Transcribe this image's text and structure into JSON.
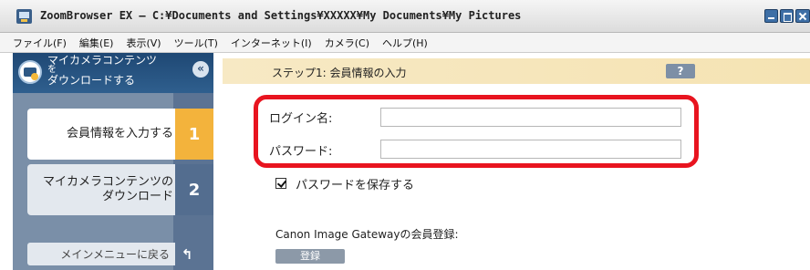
{
  "window": {
    "title": "ZoomBrowser EX  –  C:¥Documents and Settings¥XXXXX¥My Documents¥My Pictures",
    "icon": "zoombrowser-app-icon"
  },
  "menu": [
    "ファイル(F)",
    "編集(E)",
    "表示(V)",
    "ツール(T)",
    "インターネット(I)",
    "カメラ(C)",
    "ヘルプ(H)"
  ],
  "sidebar": {
    "title_line1": "マイカメラコンテンツ",
    "title_line2": "を",
    "title_line3": "ダウンロードする",
    "collapse_glyph": "«",
    "steps": [
      {
        "label": "会員情報を入力する",
        "number": "1",
        "state": "active"
      },
      {
        "label_line1": "マイカメラコンテンツの",
        "label_line2": "ダウンロード",
        "number": "2",
        "state": "inactive"
      }
    ],
    "return_label": "メインメニューに戻る",
    "return_glyph": "↰"
  },
  "main": {
    "step_title": "ステップ1: 会員情報の入力",
    "help_label": "?",
    "login_label": "ログイン名:",
    "login_value": "",
    "password_label": "パスワード:",
    "password_value": "",
    "remember_label": "パスワードを保存する",
    "remember_checked": true,
    "registration_label": "Canon Image Gatewayの会員登録:",
    "register_button": "登録"
  },
  "colors": {
    "accent_step": "#f3b33c",
    "sidebar_header": "#1f4874",
    "highlight_border": "#e8141f",
    "step_bar": "#f7e9c4"
  }
}
